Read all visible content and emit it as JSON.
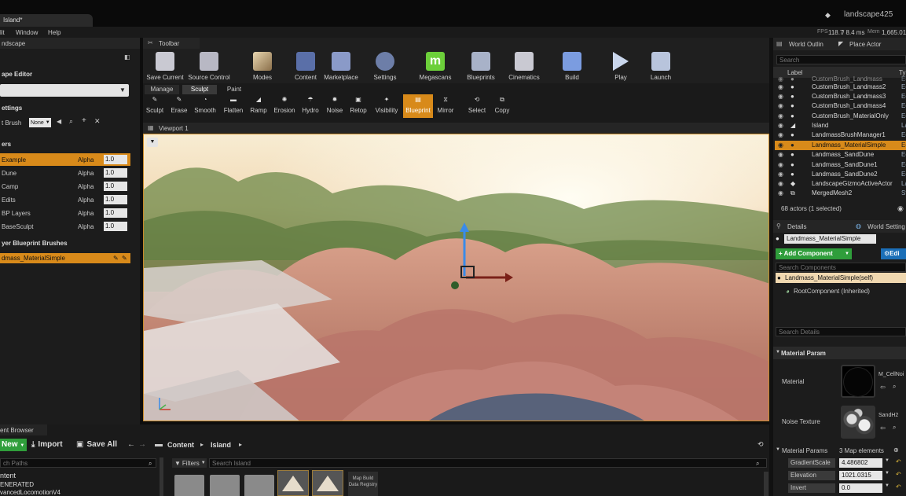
{
  "titlebar": {
    "tab": "Island*",
    "project": "landscape425"
  },
  "menu": [
    "lit",
    "Window",
    "Help"
  ],
  "stats": {
    "fps_label": "FPS",
    "fps": "118.7",
    "ms": "/ 8.4 ms",
    "mem_label": "Mem",
    "mem": "1,665.01"
  },
  "left_panel": {
    "tab": "ndscape",
    "editor_title": "ape Editor",
    "settings_label": "ettings",
    "brush_label": "t Brush",
    "brush_value": "None",
    "layers_label": "ers",
    "layers": [
      {
        "name": "Example",
        "mode": "Alpha",
        "value": "1.0",
        "selected": true
      },
      {
        "name": "Dune",
        "mode": "Alpha",
        "value": "1.0"
      },
      {
        "name": "Camp",
        "mode": "Alpha",
        "value": "1.0"
      },
      {
        "name": "Edits",
        "mode": "Alpha",
        "value": "1.0"
      },
      {
        "name": "BP Layers",
        "mode": "Alpha",
        "value": "1.0"
      },
      {
        "name": "BaseSculpt",
        "mode": "Alpha",
        "value": "1.0"
      }
    ],
    "bp_brushes_label": "yer Blueprint Brushes",
    "bp_brush_item": "dmass_MaterialSimple"
  },
  "toolbar": {
    "title": "Toolbar",
    "buttons": [
      "Save Current",
      "Source Control",
      "Modes",
      "Content",
      "Marketplace",
      "Settings",
      "Megascans",
      "Blueprints",
      "Cinematics",
      "Build",
      "Play",
      "Launch"
    ]
  },
  "mode_tabs": [
    "Manage",
    "Sculpt",
    "Paint"
  ],
  "sculpt_tools": [
    "Sculpt",
    "Erase",
    "Smooth",
    "Flatten",
    "Ramp",
    "Erosion",
    "Hydro",
    "Noise",
    "Retop",
    "Visibility",
    "Blueprint",
    "Mirror",
    "Select",
    "Copy"
  ],
  "viewport": {
    "tab": "Viewport 1"
  },
  "outliner": {
    "tab": "World Outlin",
    "tab2": "Place Actor",
    "search_placeholder": "Search",
    "col_label": "Label",
    "col_type": "Ty",
    "rows": [
      {
        "label": "CustomBrush_Landmass",
        "type": "Ec"
      },
      {
        "label": "CustomBrush_Landmass2",
        "type": "Ec"
      },
      {
        "label": "CustomBrush_Landmass3",
        "type": "Ec"
      },
      {
        "label": "CustomBrush_Landmass4",
        "type": "Ec"
      },
      {
        "label": "CustomBrush_MaterialOnly",
        "type": "Ec"
      },
      {
        "label": "Island",
        "type": "La"
      },
      {
        "label": "LandmassBrushManager1",
        "type": "Ec"
      },
      {
        "label": "Landmass_MaterialSimple",
        "type": "Ec",
        "selected": true
      },
      {
        "label": "Landmass_SandDune",
        "type": "Ec"
      },
      {
        "label": "Landmass_SandDune1",
        "type": "Ec"
      },
      {
        "label": "Landmass_SandDune2",
        "type": "Ec"
      },
      {
        "label": "LandscapeGizmoActiveActor",
        "type": "La"
      },
      {
        "label": "MergedMesh2",
        "type": "St"
      }
    ],
    "count": "68 actors (1 selected)"
  },
  "details": {
    "tab": "Details",
    "tab2": "World Setting",
    "name": "Landmass_MaterialSimple",
    "add_component": "+ Add Component",
    "edit_bp": "Edi",
    "search_components": "Search Components",
    "self_row": "Landmass_MaterialSimple(self)",
    "root_row": "RootComponent (Inherited)",
    "search_details": "Search Details",
    "section": "Material Param",
    "material_label": "Material",
    "material_asset": "M_CellNoi",
    "noise_label": "Noise Texture",
    "noise_asset": "SandH2",
    "params_label": "Material Params",
    "params_count": "3 Map elements",
    "params": [
      {
        "name": "GradientScale",
        "value": "4.486802"
      },
      {
        "name": "Elevation",
        "value": "1021.0315"
      },
      {
        "name": "Invert",
        "value": "0.0"
      }
    ]
  },
  "content_browser": {
    "tab": "ent Browser",
    "new_label": "New",
    "import_label": "Import",
    "save_all_label": "Save All",
    "path": [
      "Content",
      "Island"
    ],
    "search_paths": "ch Paths",
    "filters": "Filters",
    "search_island": "Search Island",
    "tree": [
      "ntent",
      "ENERATED",
      "vancedLocomotionV4"
    ],
    "asset_label": "Map Build Data Registry"
  },
  "colors": {
    "accent_orange": "#d88a1a",
    "green": "#2f9e3b",
    "blue": "#1b6fb8"
  }
}
